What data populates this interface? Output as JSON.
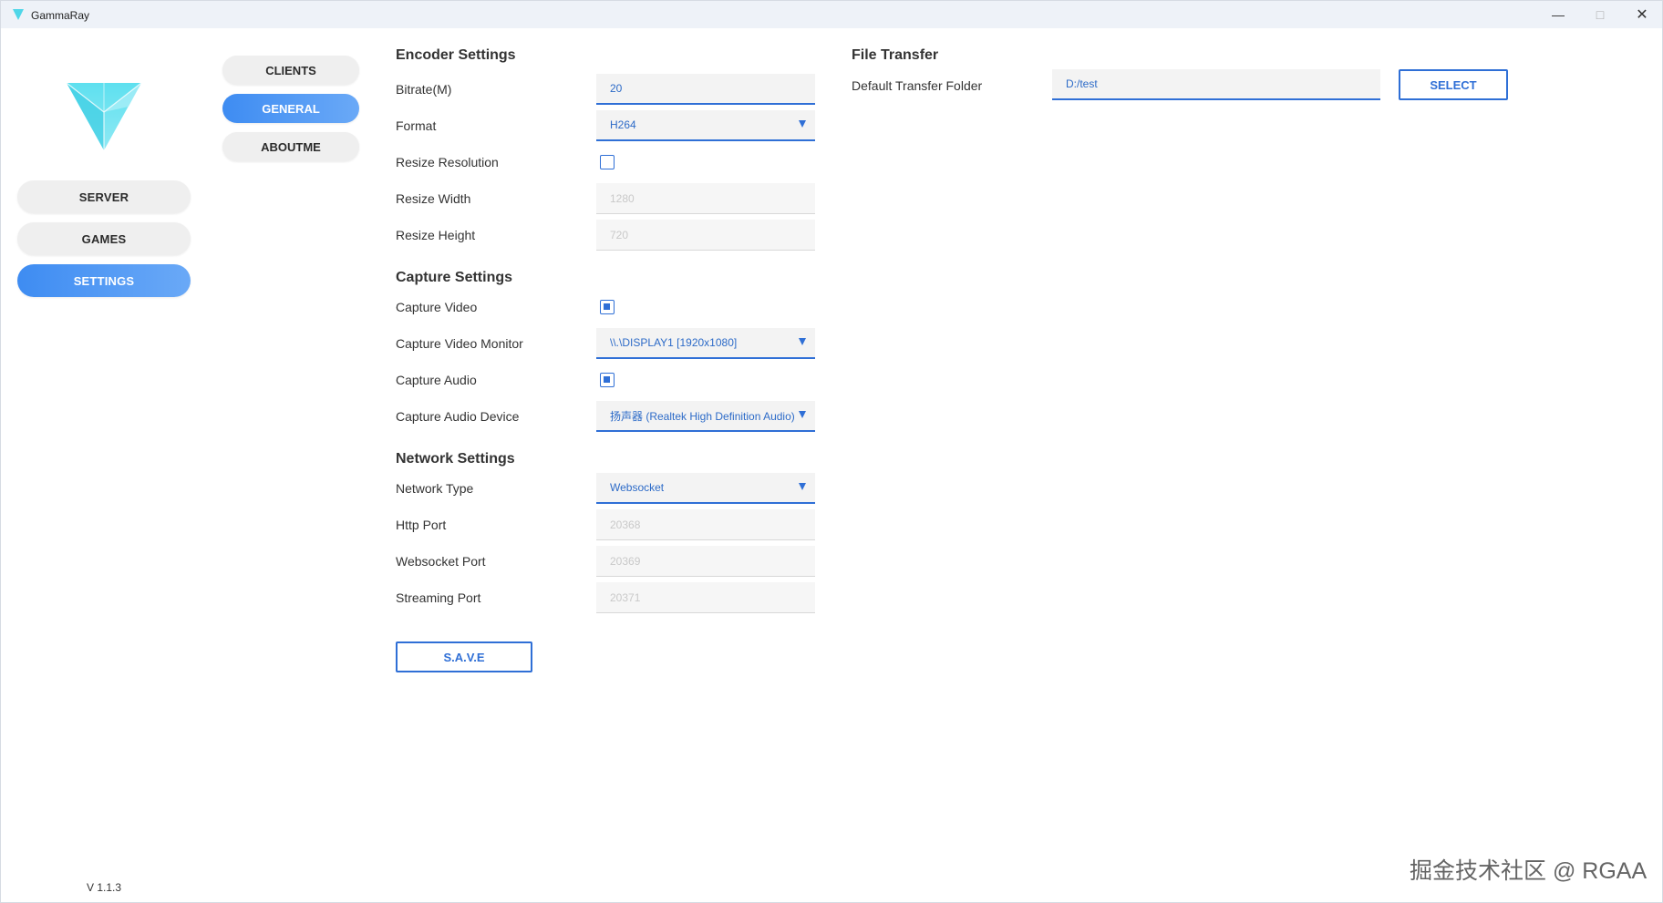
{
  "window": {
    "title": "GammaRay"
  },
  "sidebar": {
    "items": [
      {
        "label": "SERVER",
        "active": false
      },
      {
        "label": "GAMES",
        "active": false
      },
      {
        "label": "SETTINGS",
        "active": true
      }
    ],
    "version": "V 1.1.3"
  },
  "subnav": {
    "items": [
      {
        "label": "CLIENTS",
        "active": false
      },
      {
        "label": "GENERAL",
        "active": true
      },
      {
        "label": "ABOUTME",
        "active": false
      }
    ]
  },
  "encoder": {
    "title": "Encoder Settings",
    "bitrate": {
      "label": "Bitrate(M)",
      "value": "20"
    },
    "format": {
      "label": "Format",
      "value": "H264"
    },
    "resize_resolution": {
      "label": "Resize Resolution",
      "checked": false
    },
    "resize_width": {
      "label": "Resize Width",
      "value": "1280"
    },
    "resize_height": {
      "label": "Resize Height",
      "value": "720"
    }
  },
  "capture": {
    "title": "Capture Settings",
    "capture_video": {
      "label": "Capture Video",
      "checked": true
    },
    "video_monitor": {
      "label": "Capture Video Monitor",
      "value": "\\\\.\\DISPLAY1 [1920x1080]"
    },
    "capture_audio": {
      "label": "Capture Audio",
      "checked": true
    },
    "audio_device": {
      "label": "Capture Audio Device",
      "value": "扬声器 (Realtek High Definition Audio)"
    }
  },
  "network": {
    "title": "Network Settings",
    "network_type": {
      "label": "Network Type",
      "value": "Websocket"
    },
    "http_port": {
      "label": "Http Port",
      "value": "20368"
    },
    "websocket_port": {
      "label": "Websocket Port",
      "value": "20369"
    },
    "streaming_port": {
      "label": "Streaming Port",
      "value": "20371"
    }
  },
  "save_label": "S.A.V.E",
  "file_transfer": {
    "title": "File Transfer",
    "folder_label": "Default Transfer Folder",
    "folder_value": "D:/test",
    "select_label": "SELECT"
  },
  "watermark": "掘金技术社区 @ RGAA",
  "colors": {
    "accent": "#2f6fd6",
    "pill_active_start": "#3e8cf2",
    "pill_active_end": "#6aa9f7"
  }
}
